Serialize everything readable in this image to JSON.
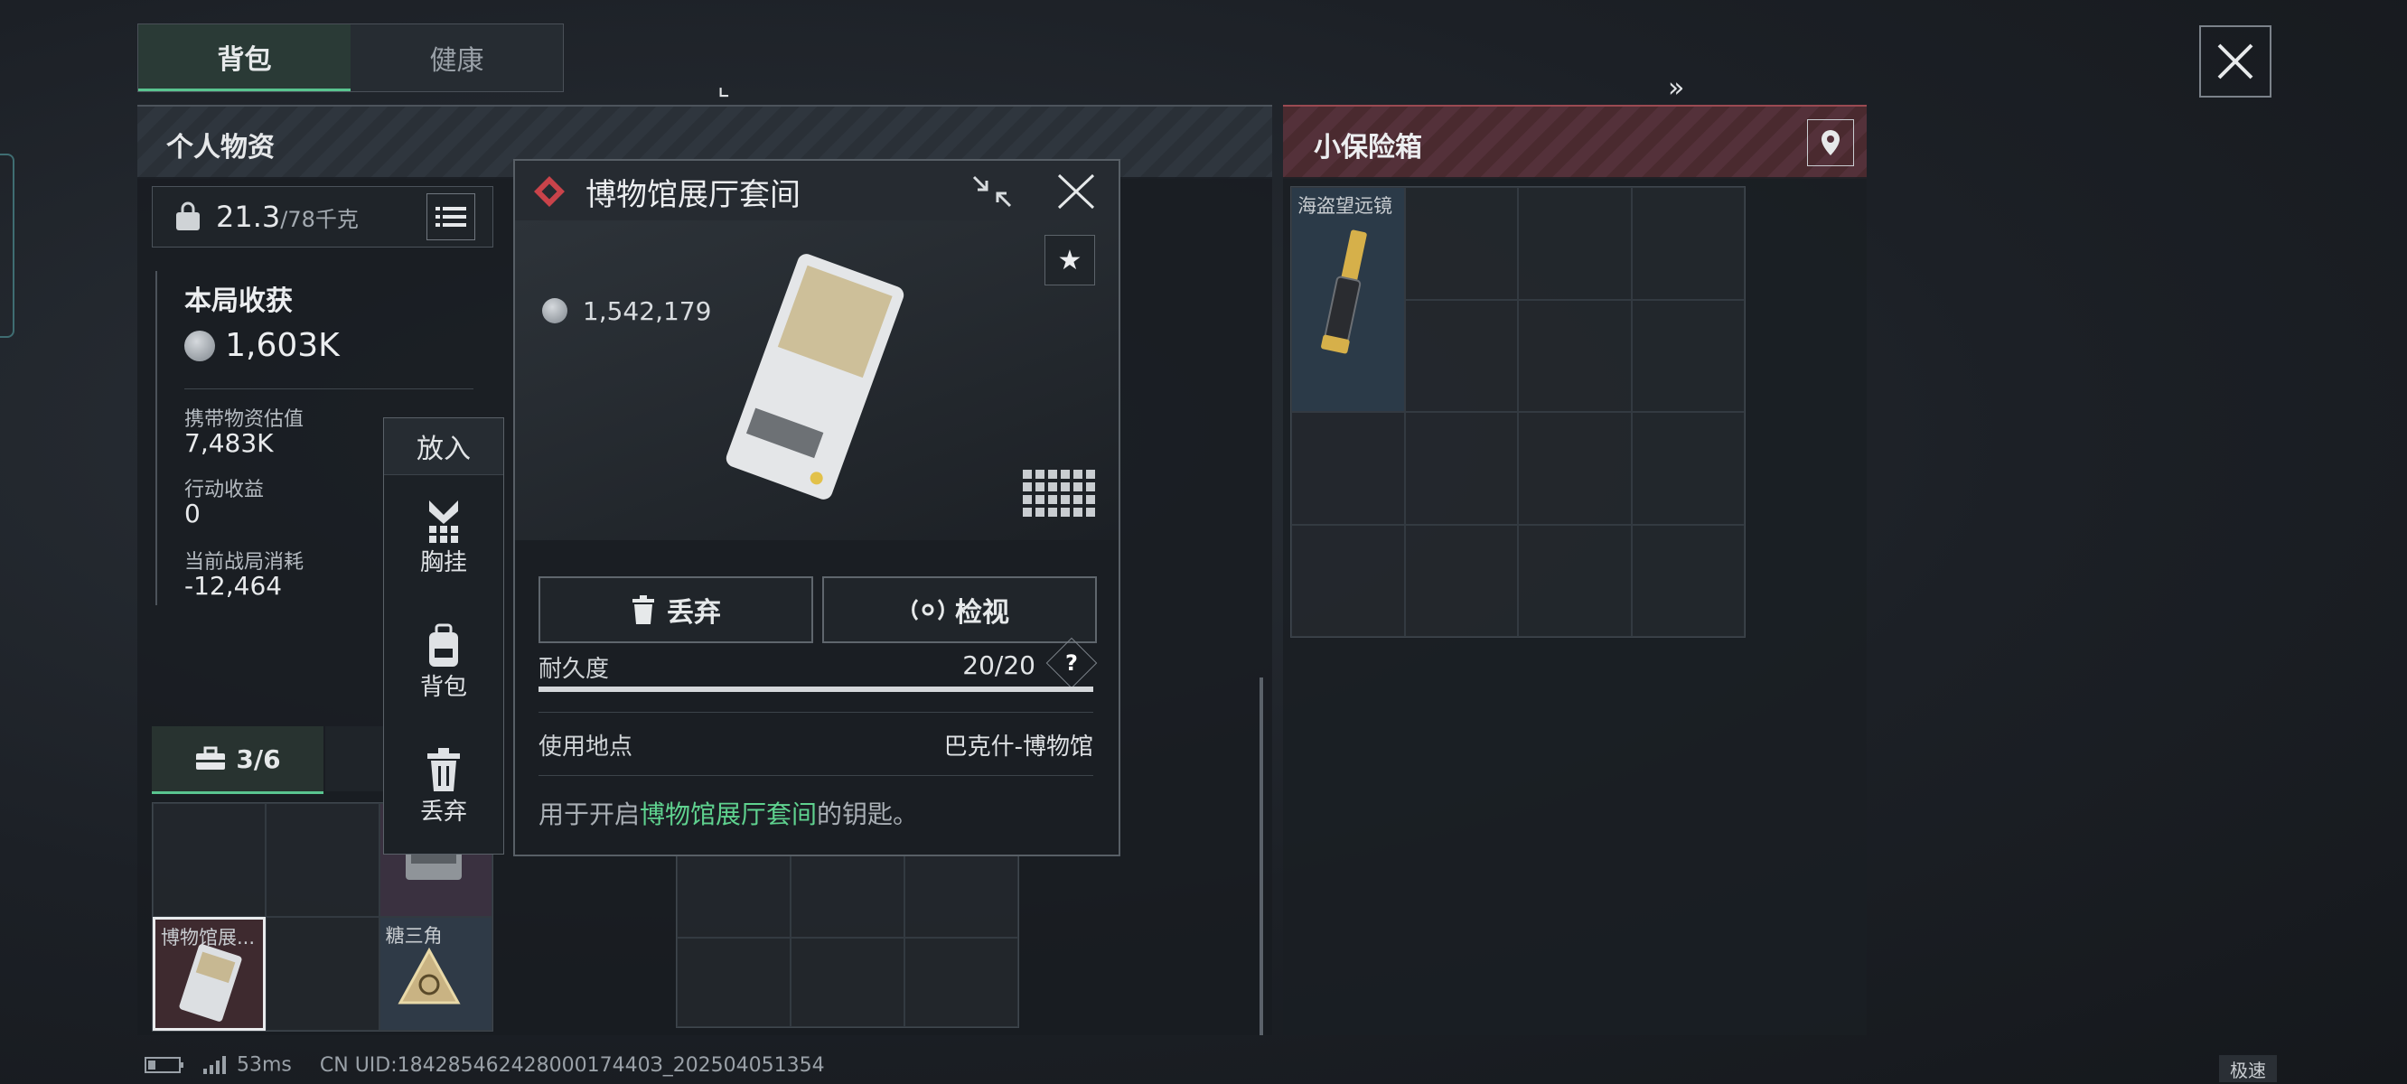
{
  "tabs": [
    {
      "label": "背包"
    },
    {
      "label": "健康"
    }
  ],
  "left": {
    "title": "个人物资",
    "weight": "21.3",
    "weight_max": "/78千克",
    "session_title": "本局收获",
    "session_value": "1,603K",
    "carry_label": "携带物资估值",
    "carry_value": "7,483K",
    "action_label": "行动收益",
    "action_value": "0",
    "cost_label": "当前战局消耗",
    "cost_value": "-12,464",
    "subtab_count": "3/6",
    "items": [
      {
        "name": "博物馆展..."
      },
      {
        "name": "糖三角"
      }
    ]
  },
  "put_menu": {
    "title": "放入",
    "items": [
      {
        "label": "胸挂"
      },
      {
        "label": "背包"
      },
      {
        "label": "丢弃"
      }
    ]
  },
  "popup": {
    "title": "博物馆展厅套间",
    "price": "1,542,179",
    "discard": "丢弃",
    "inspect": "检视",
    "durability_label": "耐久度",
    "durability_value": "20/20",
    "help": "?",
    "location_label": "使用地点",
    "location_value": "巴克什-博物馆",
    "desc_prefix": "用于开启",
    "desc_highlight": "博物馆展厅套间",
    "desc_suffix": "的钥匙。"
  },
  "right": {
    "title": "小保险箱",
    "item": "海盗望远镜"
  },
  "status": {
    "latency": "53ms",
    "uid": "CN UID:18428546242800017440З_202504051354",
    "speed": "极速"
  },
  "colors": {
    "accent": "#59c48f",
    "safe": "#8a3e46",
    "highlight": "#5fd28f"
  }
}
